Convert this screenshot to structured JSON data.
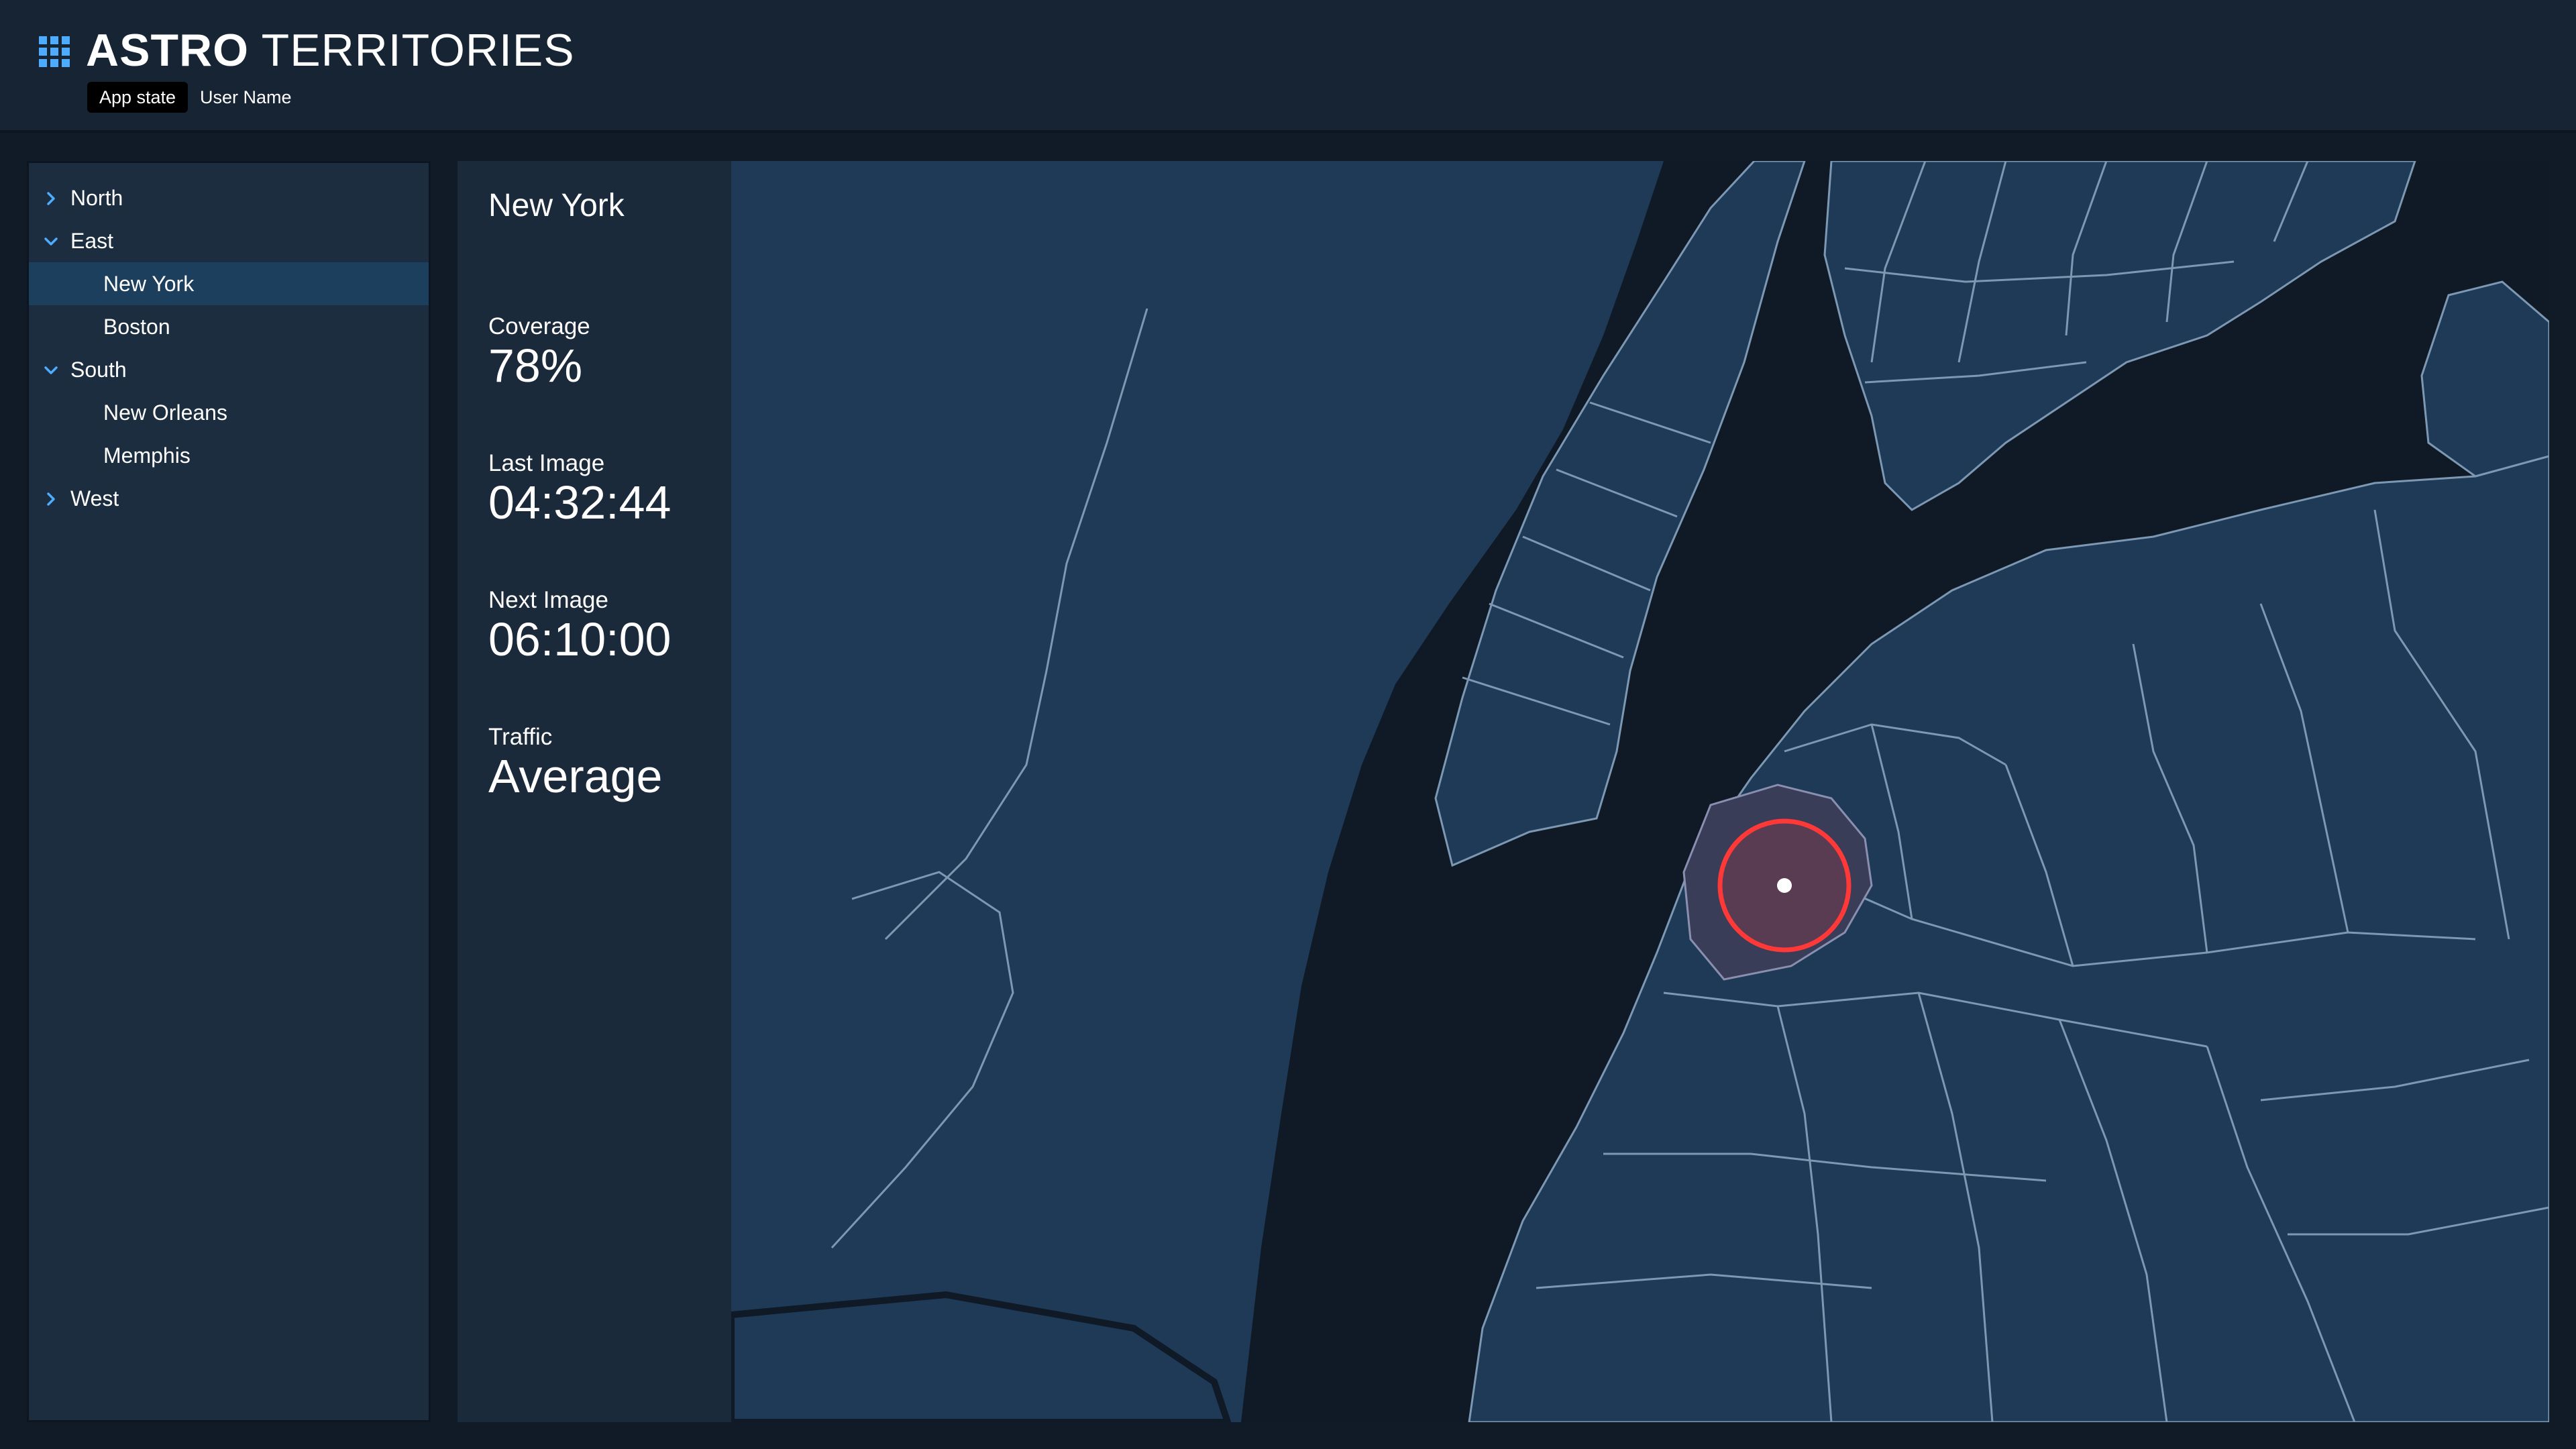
{
  "header": {
    "title_strong": "ASTRO",
    "title_light": "TERRITORIES",
    "app_state": "App state",
    "user_name": "User Name",
    "icon": "waffle-grid-icon",
    "accent_color": "#4dacff"
  },
  "tree": {
    "items": [
      {
        "label": "North",
        "level": 0,
        "chevron": "chevron-right-icon",
        "expanded": false
      },
      {
        "label": "East",
        "level": 0,
        "chevron": "chevron-down-icon",
        "expanded": true
      },
      {
        "label": "New York",
        "level": 1,
        "selected": true
      },
      {
        "label": "Boston",
        "level": 1
      },
      {
        "label": "South",
        "level": 0,
        "chevron": "chevron-down-icon",
        "expanded": true
      },
      {
        "label": "New Orleans",
        "level": 1
      },
      {
        "label": "Memphis",
        "level": 1
      },
      {
        "label": "West",
        "level": 0,
        "chevron": "chevron-right-icon",
        "expanded": false
      }
    ]
  },
  "details": {
    "title": "New York",
    "coverage": {
      "label": "Coverage",
      "value": "78%"
    },
    "last_image": {
      "label": "Last Image",
      "value": "04:32:44"
    },
    "next_image": {
      "label": "Next Image",
      "value": "06:10:00"
    },
    "traffic": {
      "label": "Traffic",
      "value": "Average"
    }
  },
  "map": {
    "land_color": "#1e3a57",
    "water_color": "#0f1a26",
    "border_color": "#7d98b3",
    "marker_color": "#ff3838",
    "marker_icon": "location-target-icon"
  }
}
